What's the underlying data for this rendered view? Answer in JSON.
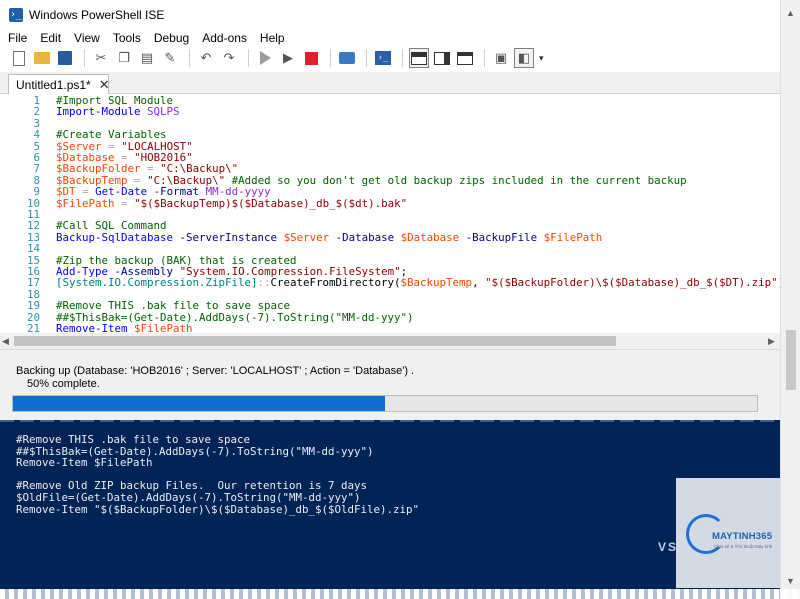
{
  "window": {
    "title": "Windows PowerShell ISE"
  },
  "menu": [
    "File",
    "Edit",
    "View",
    "Tools",
    "Debug",
    "Add-ons",
    "Help"
  ],
  "tabs": [
    {
      "label": "Untitled1.ps1*",
      "close_glyph": "✕"
    }
  ],
  "editor": {
    "lines": [
      {
        "n": "1",
        "tokens": [
          [
            "cm",
            "#Import SQL Module"
          ]
        ]
      },
      {
        "n": "2",
        "tokens": [
          [
            "cmd",
            "Import-Module"
          ],
          [
            "tx",
            " "
          ],
          [
            "arg",
            "SQLPS"
          ]
        ]
      },
      {
        "n": "3",
        "tokens": []
      },
      {
        "n": "4",
        "tokens": [
          [
            "cm",
            "#Create Variables"
          ]
        ]
      },
      {
        "n": "5",
        "tokens": [
          [
            "var",
            "$Server"
          ],
          [
            "tx",
            " "
          ],
          [
            "op",
            "="
          ],
          [
            "tx",
            " "
          ],
          [
            "str",
            "\"LOCALHOST\""
          ]
        ]
      },
      {
        "n": "6",
        "tokens": [
          [
            "var",
            "$Database"
          ],
          [
            "tx",
            " "
          ],
          [
            "op",
            "="
          ],
          [
            "tx",
            " "
          ],
          [
            "str",
            "\"HOB2016\""
          ]
        ]
      },
      {
        "n": "7",
        "tokens": [
          [
            "var",
            "$BackupFolder"
          ],
          [
            "tx",
            " "
          ],
          [
            "op",
            "="
          ],
          [
            "tx",
            " "
          ],
          [
            "str",
            "\"C:\\Backup\\\""
          ]
        ]
      },
      {
        "n": "8",
        "tokens": [
          [
            "var",
            "$BackupTemp"
          ],
          [
            "tx",
            " "
          ],
          [
            "op",
            "="
          ],
          [
            "tx",
            " "
          ],
          [
            "str",
            "\"C:\\Backup\\\""
          ],
          [
            "tx",
            " "
          ],
          [
            "cm",
            "#Added so you don't get old backup zips included in the current backup"
          ]
        ]
      },
      {
        "n": "9",
        "tokens": [
          [
            "var",
            "$DT"
          ],
          [
            "tx",
            " "
          ],
          [
            "op",
            "="
          ],
          [
            "tx",
            " "
          ],
          [
            "cmd",
            "Get-Date"
          ],
          [
            "tx",
            " "
          ],
          [
            "pm",
            "-Format"
          ],
          [
            "tx",
            " "
          ],
          [
            "arg",
            "MM-dd-yyyy"
          ]
        ]
      },
      {
        "n": "10",
        "tokens": [
          [
            "var",
            "$FilePath"
          ],
          [
            "tx",
            " "
          ],
          [
            "op",
            "="
          ],
          [
            "tx",
            " "
          ],
          [
            "str",
            "\"$($BackupTemp)$($Database)_db_$($dt).bak\""
          ]
        ]
      },
      {
        "n": "11",
        "tokens": []
      },
      {
        "n": "12",
        "tokens": [
          [
            "cm",
            "#Call SQL Command"
          ]
        ]
      },
      {
        "n": "13",
        "tokens": [
          [
            "cmd",
            "Backup-SqlDatabase"
          ],
          [
            "tx",
            " "
          ],
          [
            "pm",
            "-ServerInstance"
          ],
          [
            "tx",
            " "
          ],
          [
            "var",
            "$Server"
          ],
          [
            "tx",
            " "
          ],
          [
            "pm",
            "-Database"
          ],
          [
            "tx",
            " "
          ],
          [
            "var",
            "$Database"
          ],
          [
            "tx",
            " "
          ],
          [
            "pm",
            "-BackupFile"
          ],
          [
            "tx",
            " "
          ],
          [
            "var",
            "$FilePath"
          ]
        ]
      },
      {
        "n": "14",
        "tokens": []
      },
      {
        "n": "15",
        "tokens": [
          [
            "cm",
            "#Zip the backup (BAK) that is created"
          ]
        ]
      },
      {
        "n": "16",
        "tokens": [
          [
            "cmd",
            "Add-Type"
          ],
          [
            "tx",
            " "
          ],
          [
            "pm",
            "-Assembly"
          ],
          [
            "tx",
            " "
          ],
          [
            "str",
            "\"System.IO.Compression.FileSystem\""
          ],
          [
            "tx",
            ";"
          ]
        ]
      },
      {
        "n": "17",
        "tokens": [
          [
            "ty",
            "[System.IO.Compression.ZipFile]"
          ],
          [
            "op",
            "::"
          ],
          [
            "tx",
            "CreateFromDirectory("
          ],
          [
            "var",
            "$BackupTemp"
          ],
          [
            "tx",
            ", "
          ],
          [
            "str",
            "\"$($BackupFolder)\\$($Database)_db_$($DT).zip\""
          ],
          [
            "tx",
            ");"
          ]
        ]
      },
      {
        "n": "18",
        "tokens": []
      },
      {
        "n": "19",
        "tokens": [
          [
            "cm",
            "#Remove THIS .bak file to save space"
          ]
        ]
      },
      {
        "n": "20",
        "tokens": [
          [
            "cm",
            "##$ThisBak=(Get-Date).AddDays(-7).ToString(\"MM-dd-yyy\")"
          ]
        ]
      },
      {
        "n": "21",
        "tokens": [
          [
            "cmd",
            "Remove-Item"
          ],
          [
            "tx",
            " "
          ],
          [
            "var",
            "$FilePath"
          ]
        ]
      }
    ]
  },
  "progress": {
    "status": "Backing up (Database: 'HOB2016' ; Server: 'LOCALHOST' ; Action = 'Database') .",
    "percent_label": "50% complete.",
    "fraction": 0.5
  },
  "console": {
    "lines": [
      "#Remove THIS .bak file to save space",
      "##$ThisBak=(Get-Date).AddDays(-7).ToString(\"MM-dd-yyy\")",
      "Remove-Item $FilePath",
      "",
      "#Remove Old ZIP backup Files.  Our retention is 7 days",
      "$OldFile=(Get-Date).AddDays(-7).ToString(\"MM-dd-yyy\")",
      "Remove-Item \"$($BackupFolder)\\$($Database)_db_$($OldFile).zip\""
    ]
  },
  "watermark": {
    "brand": "MAYTINH365",
    "tagline": "Chia sẻ & Thủ thuật Máy tính",
    "side_letters": "VS"
  },
  "colors": {
    "console_bg": "#012456",
    "progress_fill": "#0f6fd0",
    "stop_button": "#d9222a"
  }
}
